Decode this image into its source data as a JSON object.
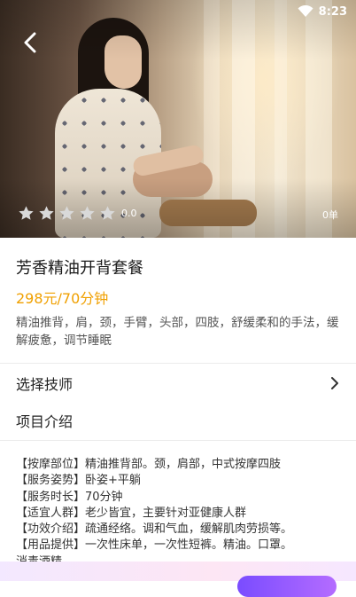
{
  "status_bar": {
    "time": "8:23",
    "wifi_icon": "wifi-icon"
  },
  "hero": {
    "back_icon": "chevron-left-icon",
    "rating": {
      "stars_total": 5,
      "stars_filled": 0,
      "score": "0.0"
    },
    "orders": "0单"
  },
  "service": {
    "title": "芳香精油开背套餐",
    "price": "298元/70分钟",
    "description": "精油推背，肩，颈，手臂，头部，四肢，舒缓柔和的手法，缓解疲惫，调节睡眠"
  },
  "sections": {
    "choose_technician": "选择技师",
    "chevron_icon": "chevron-right-icon",
    "project_intro": "项目介绍"
  },
  "details": [
    "【按摩部位】精油推背部。颈，肩部，中式按摩四肢",
    "【服务姿势】卧姿+平躺",
    "【服务时长】70分钟",
    "【适宜人群】老少皆宜，主要针对亚健康人群",
    "【功效介绍】疏通经络。调和气血，缓解肌肉劳损等。",
    "【用品提供】一次性床单，一次性短裤。精油。口罩。",
    "消毒酒精"
  ],
  "colors": {
    "price": "#f0a000",
    "star_empty": "#d9d9d9",
    "bottom_button": "#7a4cff"
  }
}
